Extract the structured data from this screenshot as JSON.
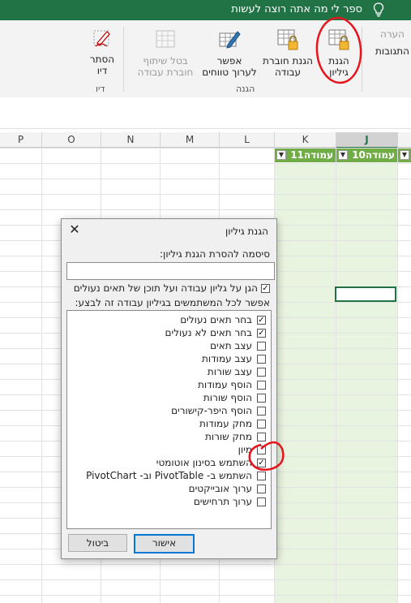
{
  "tellme": {
    "text": "ספר לי מה אתה רוצה לעשות",
    "icon": "lightbulb-icon"
  },
  "ribbon": {
    "partial_comment": "הערה",
    "partial_comments": "התגובות",
    "protect_sheet": {
      "line1": "הגנת",
      "line2": "גיליון"
    },
    "protect_workbook": {
      "line1": "הגנת חוברת",
      "line2": "עבודה"
    },
    "allow_edit_ranges": {
      "line1": "אפשר",
      "line2": "לערוך טווחים"
    },
    "unshare_workbook": {
      "line1": "בטל שיתוף",
      "line2": "חוברת עבודה"
    },
    "hide_ink": {
      "line1": "הסתר",
      "line2": "דיו"
    },
    "group_protect": "הגנה",
    "group_ink": "דיו"
  },
  "columns": [
    "P",
    "O",
    "N",
    "M",
    "L",
    "K",
    "J"
  ],
  "table_headers": [
    "עמודה11",
    "עמודה10"
  ],
  "dialog": {
    "title": "הגנת גיליון",
    "password_label": "סיסמה להסרת הגנת גיליון:",
    "password_value": "",
    "protect_contents": "הגן על גליון עבודה ועל תוכן של תאים נעולים",
    "allow_label": "אפשר לכל המשתמשים בגיליון עבודה זה לבצע:",
    "options": [
      {
        "label": "בחר תאים נעולים",
        "checked": true
      },
      {
        "label": "בחר תאים לא נעולים",
        "checked": true
      },
      {
        "label": "עצב תאים",
        "checked": false
      },
      {
        "label": "עצב עמודות",
        "checked": false
      },
      {
        "label": "עצב שורות",
        "checked": false
      },
      {
        "label": "הוסף עמודות",
        "checked": false
      },
      {
        "label": "הוסף שורות",
        "checked": false
      },
      {
        "label": "הוסף היפר-קישורים",
        "checked": false
      },
      {
        "label": "מחק עמודות",
        "checked": false
      },
      {
        "label": "מחק שורות",
        "checked": false
      },
      {
        "label": "מיון",
        "checked": false
      },
      {
        "label": "השתמש בסינון אוטומטי",
        "checked": true
      },
      {
        "label": "השתמש ב- PivotTable וב- PivotChart",
        "checked": false
      },
      {
        "label": "ערוך אובייקטים",
        "checked": false
      },
      {
        "label": "ערוך תרחישים",
        "checked": false
      }
    ],
    "ok": "אישור",
    "cancel": "ביטול",
    "check_mark": "✓",
    "close": "✕"
  },
  "colors": {
    "excel_green": "#217346",
    "table_green": "#70ad47",
    "annotation_red": "#e8141c"
  }
}
